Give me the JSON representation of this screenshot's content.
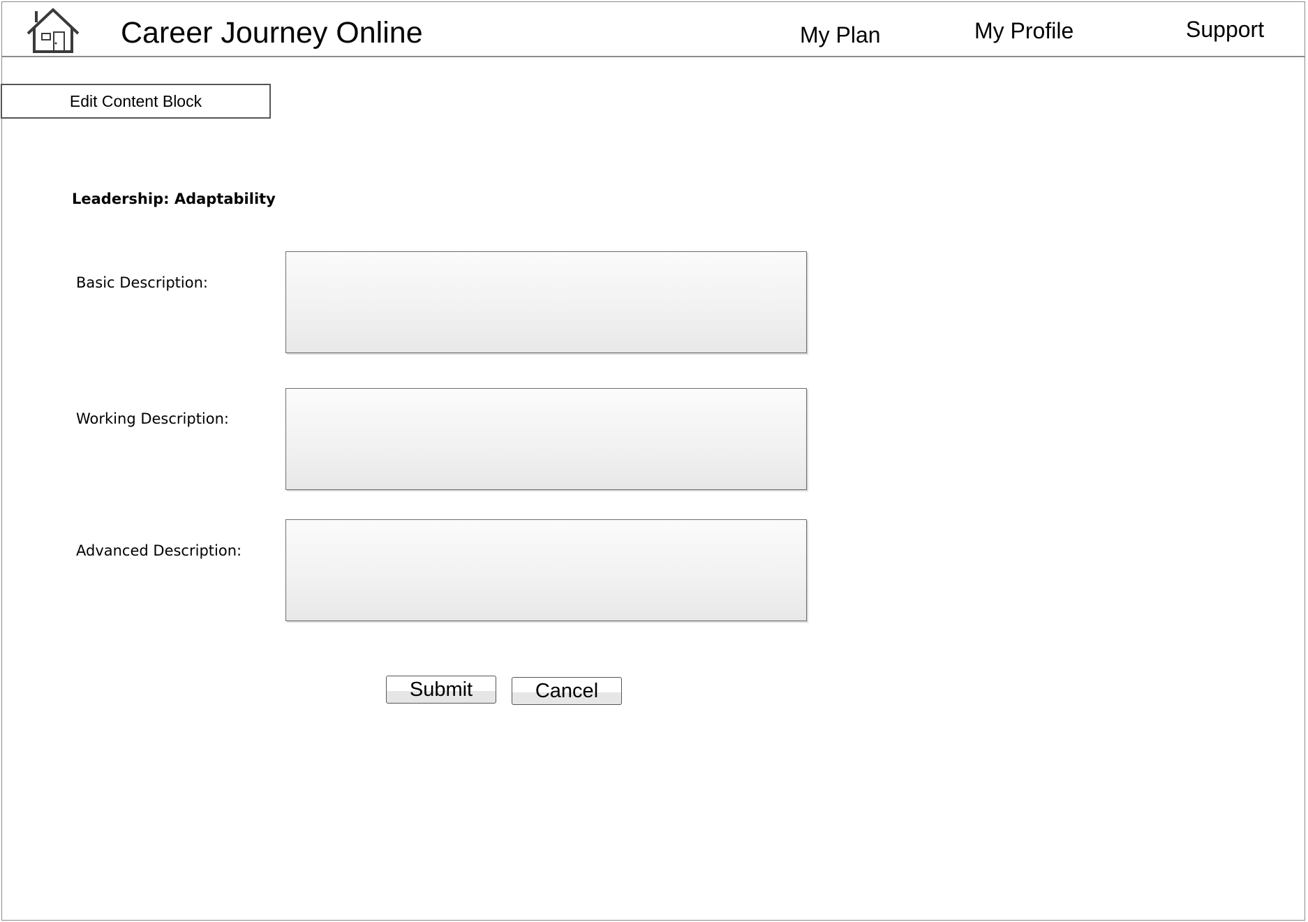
{
  "header": {
    "home_icon": "house-icon",
    "app_title": "Career Journey Online",
    "nav": [
      {
        "label": "My Plan"
      },
      {
        "label": "My Profile"
      },
      {
        "label": "Support"
      }
    ]
  },
  "page": {
    "heading": "Edit Content Block",
    "section_title": "Leadership: Adaptability"
  },
  "form": {
    "fields": [
      {
        "label": "Basic Description:",
        "value": ""
      },
      {
        "label": "Working Description:",
        "value": ""
      },
      {
        "label": "Advanced Description:",
        "value": ""
      }
    ],
    "submit_label": "Submit",
    "cancel_label": "Cancel"
  },
  "colors": {
    "border": "#8a8a8a",
    "field_fill": "#f1f1f1",
    "background": "#ffffff"
  }
}
